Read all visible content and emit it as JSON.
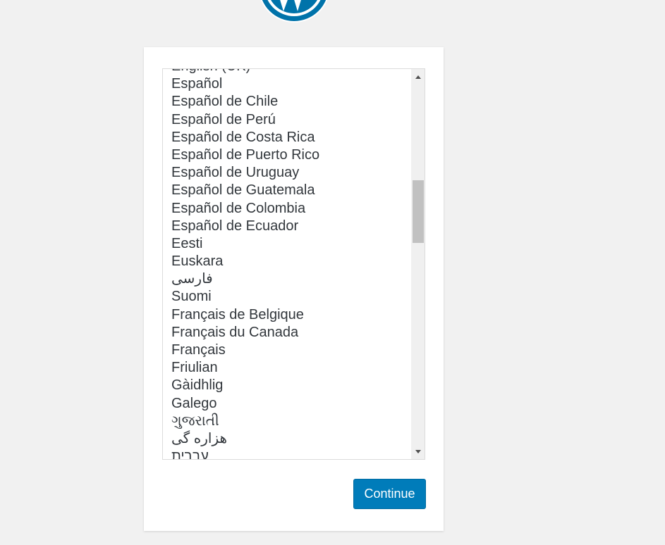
{
  "logo": {
    "icon": "wordpress-logo-icon",
    "color": "#0073aa"
  },
  "language_list": {
    "items": [
      "English (UK)",
      "Español",
      "Español de Chile",
      "Español de Perú",
      "Español de Costa Rica",
      "Español de Puerto Rico",
      "Español de Uruguay",
      "Español de Guatemala",
      "Español de Colombia",
      "Español de Ecuador",
      "Eesti",
      "Euskara",
      "فارسی",
      "Suomi",
      "Français de Belgique",
      "Français du Canada",
      "Français",
      "Friulian",
      "Gàidhlig",
      "Galego",
      "ગુજરાતી",
      "هزاره گی",
      "עברית"
    ],
    "rtl_items": [
      "فارسی",
      "هزاره گی",
      "עברית"
    ],
    "scroll_position": 0.35
  },
  "actions": {
    "continue_label": "Continue"
  },
  "colors": {
    "accent": "#007cba",
    "page_background": "#f1f1f1",
    "card_background": "#ffffff"
  }
}
